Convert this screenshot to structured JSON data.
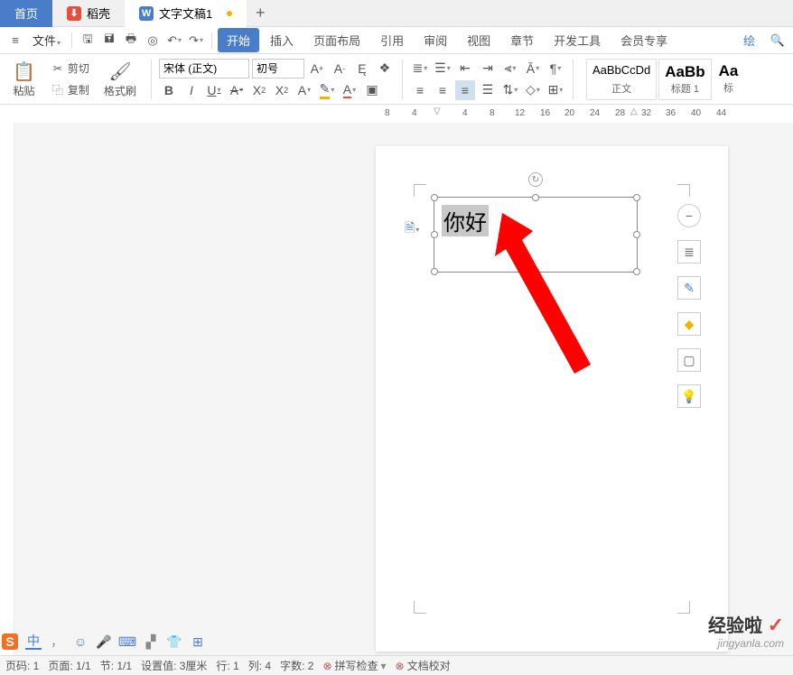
{
  "tabs": {
    "home": "首页",
    "docer": "稻壳",
    "doc": "文字文稿1"
  },
  "menu": {
    "file": "文件",
    "items": [
      "开始",
      "插入",
      "页面布局",
      "引用",
      "审阅",
      "视图",
      "章节",
      "开发工具",
      "会员专享"
    ],
    "right": "绘"
  },
  "clipboard": {
    "cut": "剪切",
    "copy": "复制",
    "paste": "粘贴",
    "brush": "格式刷"
  },
  "font": {
    "name": "宋体 (正文)",
    "size": "初号"
  },
  "styles": {
    "normal_preview": "AaBbCcDd",
    "normal_name": "正文",
    "h1_preview": "AaBb",
    "h1_name": "标题 1",
    "h2_preview": "Aa",
    "h2_name": "标"
  },
  "ruler": {
    "v0": "8",
    "v1": "4",
    "v2": "4",
    "v3": "8",
    "v4": "12",
    "v5": "16",
    "v6": "20",
    "v7": "24",
    "v8": "28",
    "v9": "32",
    "v10": "36",
    "v11": "40",
    "v12": "44"
  },
  "textbox_content": "你好",
  "status": {
    "page_no": "页码: 1",
    "page": "页面: 1/1",
    "section": "节: 1/1",
    "setting": "设置值: 3厘米",
    "row": "行: 1",
    "col": "列: 4",
    "chars": "字数: 2",
    "spellcheck": "拼写检查",
    "proof": "文档校对"
  },
  "watermark": {
    "text": "经验啦",
    "url": "jingyanla.com"
  },
  "bottom_icons": {
    "cn": "中"
  }
}
